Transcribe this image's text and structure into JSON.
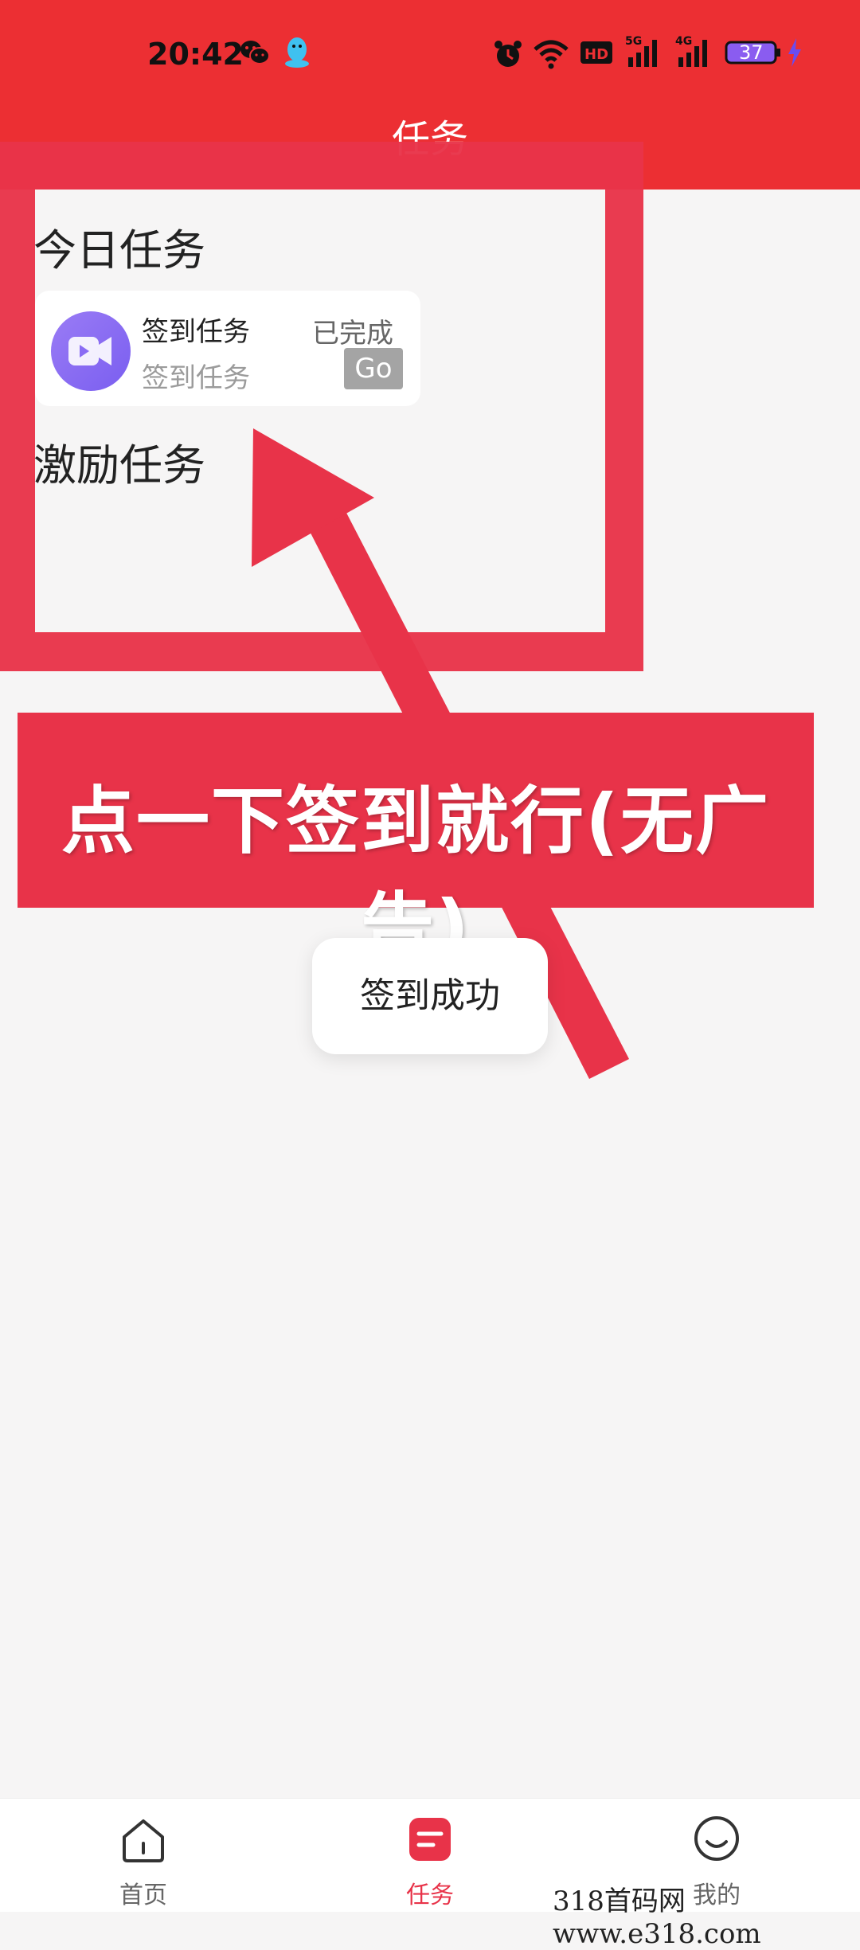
{
  "status_bar": {
    "time": "20:42",
    "battery": "37"
  },
  "header": {
    "title": "任务"
  },
  "today_section": {
    "title": "今日任务",
    "task": {
      "title": "签到任务",
      "subtitle": "签到任务",
      "status": "已完成",
      "button_label": "Go"
    }
  },
  "incentive_section": {
    "title": "激励任务"
  },
  "annotation": {
    "banner_text": "点一下签到就行(无广告)"
  },
  "toast": {
    "text": "签到成功"
  },
  "bottom_nav": {
    "items": [
      {
        "label": "首页",
        "icon": "home-icon"
      },
      {
        "label": "任务",
        "icon": "task-icon"
      },
      {
        "label": "我的",
        "icon": "profile-icon"
      }
    ]
  },
  "watermark": {
    "text": "318首码网 www.e318.com"
  },
  "colors": {
    "brand_red": "#ec2f33",
    "annotation_red": "#e83349",
    "task_icon_purple": "#8a6cf4"
  }
}
